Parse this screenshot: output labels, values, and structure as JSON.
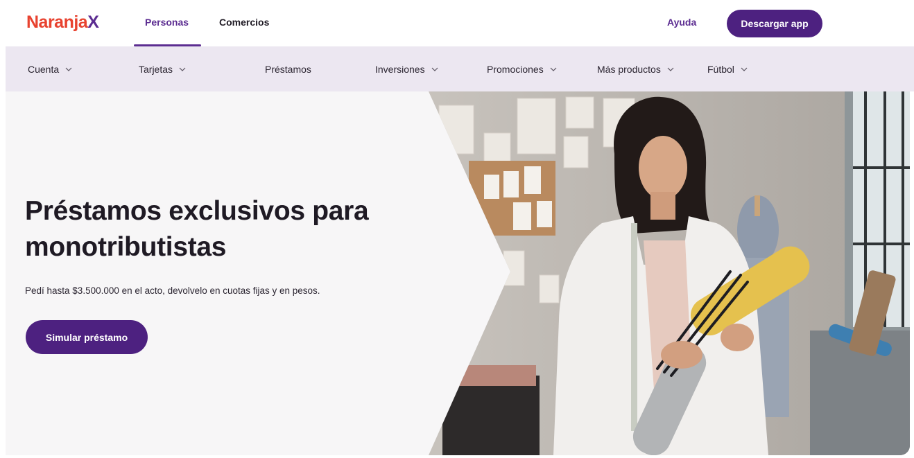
{
  "brand": {
    "logo_main": "Naranja",
    "logo_accent": "X"
  },
  "header": {
    "tabs": [
      {
        "label": "Personas",
        "active": true
      },
      {
        "label": "Comercios",
        "active": false
      }
    ],
    "help_label": "Ayuda",
    "download_label": "Descargar app"
  },
  "subnav": {
    "items": [
      {
        "label": "Cuenta",
        "has_dropdown": true
      },
      {
        "label": "Tarjetas",
        "has_dropdown": true
      },
      {
        "label": "Préstamos",
        "has_dropdown": false
      },
      {
        "label": "Inversiones",
        "has_dropdown": true
      },
      {
        "label": "Promociones",
        "has_dropdown": true
      },
      {
        "label": "Más productos",
        "has_dropdown": true
      },
      {
        "label": "Fútbol",
        "has_dropdown": true
      }
    ]
  },
  "hero": {
    "title_line1": "Préstamos exclusivos para",
    "title_line2": "monotributistas",
    "subtitle": "Pedí hasta $3.500.000 en el acto, devolvelo en cuotas fijas y en pesos.",
    "cta_label": "Simular préstamo"
  },
  "colors": {
    "brand_orange": "#e8422f",
    "brand_purple": "#5c2d91",
    "button_purple": "#4d2180",
    "subnav_bg": "#ece7f1",
    "hero_bg": "#f7f6f7"
  },
  "icons": {
    "dropdown": "chevron-down-icon"
  }
}
